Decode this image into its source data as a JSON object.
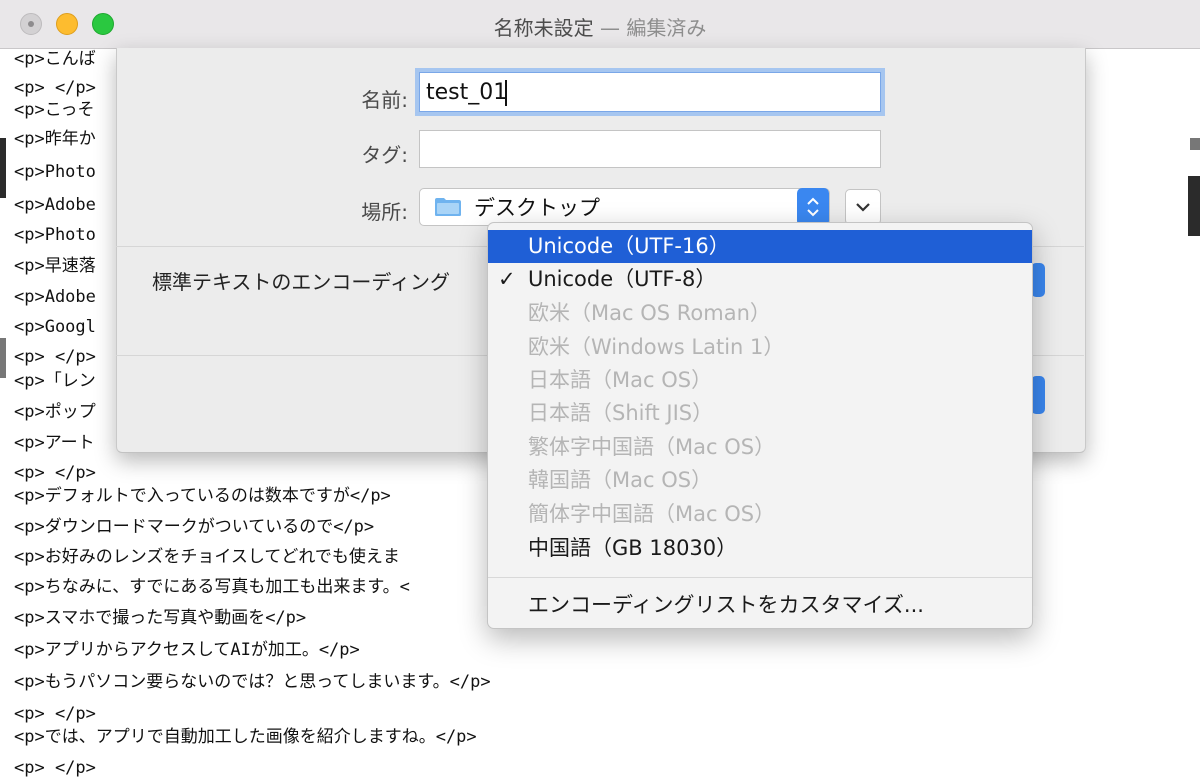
{
  "window": {
    "title_main": "名称未設定",
    "title_suffix": " — 編集済み"
  },
  "editor": {
    "lines": [
      "<p>こんば",
      "<p> </p>",
      "<p>こっそ",
      "<p>昨年か",
      "<p>Photo",
      "<p>Adobe",
      "<p>Photo",
      "<p>早速落",
      "<p>Adobe",
      "<p>Googl",
      "<p> </p>",
      "<p>「レン",
      "<p>ポップ",
      "<p>アート",
      "<p> </p>",
      "<p>デフォルトで入っているのは数本ですが</p>",
      "<p>ダウンロードマークがついているので</p>",
      "<p>お好みのレンズをチョイスしてどれでも使えま",
      "<p>ちなみに、すでにある写真も加工も出来ます。<",
      "<p>スマホで撮った写真や動画を</p>",
      "<p>アプリからアクセスしてAIが加工。</p>",
      "<p>もうパソコン要らないのでは？と思ってしまいます。</p>",
      "<p> </p>",
      "<p>では、アプリで自動加工した画像を紹介しますね。</p>",
      "<p> </p>"
    ]
  },
  "save_sheet": {
    "name_label": "名前:",
    "name_value": "test_01",
    "tags_label": "タグ:",
    "tags_value": "",
    "location_label": "場所:",
    "location_value": "デスクトップ",
    "encoding_label": "標準テキストのエンコーディング"
  },
  "encoding_menu": {
    "items": [
      {
        "label": "Unicode（UTF-16）",
        "state": "highlighted"
      },
      {
        "label": "Unicode（UTF-8）",
        "state": "checked"
      },
      {
        "label": "欧米（Mac OS Roman）",
        "state": "disabled"
      },
      {
        "label": "欧米（Windows Latin 1）",
        "state": "disabled"
      },
      {
        "label": "日本語（Mac OS）",
        "state": "disabled"
      },
      {
        "label": "日本語（Shift JIS）",
        "state": "disabled"
      },
      {
        "label": "繁体字中国語（Mac OS）",
        "state": "disabled"
      },
      {
        "label": "韓国語（Mac OS）",
        "state": "disabled"
      },
      {
        "label": "簡体字中国語（Mac OS）",
        "state": "disabled"
      },
      {
        "label": "中国語（GB 18030）",
        "state": "enabled"
      }
    ],
    "check_mark": "✓",
    "customize_label": "エンコーディングリストをカスタマイズ..."
  },
  "colors": {
    "accent": "#3a87f0",
    "menu_highlight": "#1f5fd6"
  }
}
